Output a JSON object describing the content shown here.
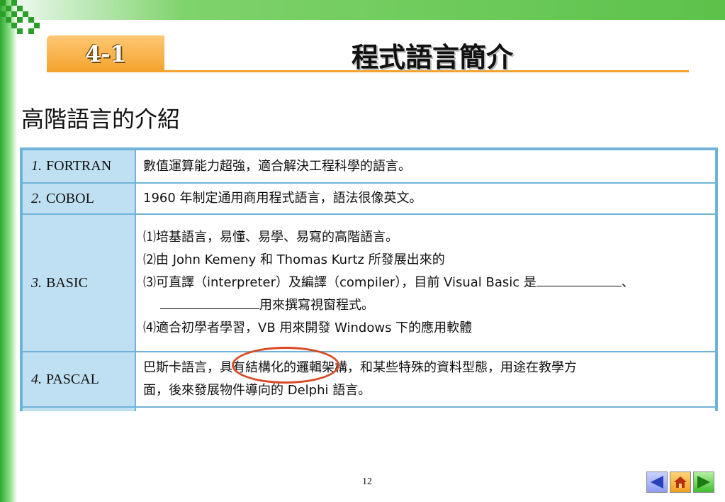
{
  "header": {
    "section_number": "4-1",
    "title": "程式語言簡介"
  },
  "section_heading": "高階語言的介紹",
  "table": {
    "rows": [
      {
        "num": "1.",
        "name": "FORTRAN",
        "lines": [
          "數值運算能力超強，適合解決工程科學的語言。"
        ]
      },
      {
        "num": "2.",
        "name": "COBOL",
        "lines": [
          "1960 年制定通用商用程式語言，語法很像英文。"
        ]
      },
      {
        "num": "3.",
        "name": "BASIC",
        "lines": [
          "⑴培基語言，易懂、易學、易寫的高階語言。",
          "⑵由 John Kemeny 和 Thomas Kurtz 所發展出來的",
          "⑶可直譯（interpreter）及編譯（compiler），目前 Visual Basic 是",
          "、",
          "用來撰寫視窗程式。",
          "⑷適合初學者學習，VB 用來開發 Windows 下的應用軟體"
        ]
      },
      {
        "num": "4.",
        "name": "PASCAL",
        "lines": [
          "巴斯卡語言，具有結構化的邏輯架構，和某些特殊的資料型態，用途在教學方",
          "面，後來發展物件導向的 Delphi 語言。"
        ]
      }
    ]
  },
  "page_number": "12",
  "nav": {
    "prev_icon": "prev-arrow-icon",
    "home_icon": "home-icon",
    "next_icon": "next-arrow-icon"
  },
  "colors": {
    "accent_orange": "#f4a32c",
    "table_border": "#6fb4d8",
    "lang_cell": "#bfe0f2",
    "annotation_red": "#d94a24",
    "frame_green": "#5cc24a"
  }
}
